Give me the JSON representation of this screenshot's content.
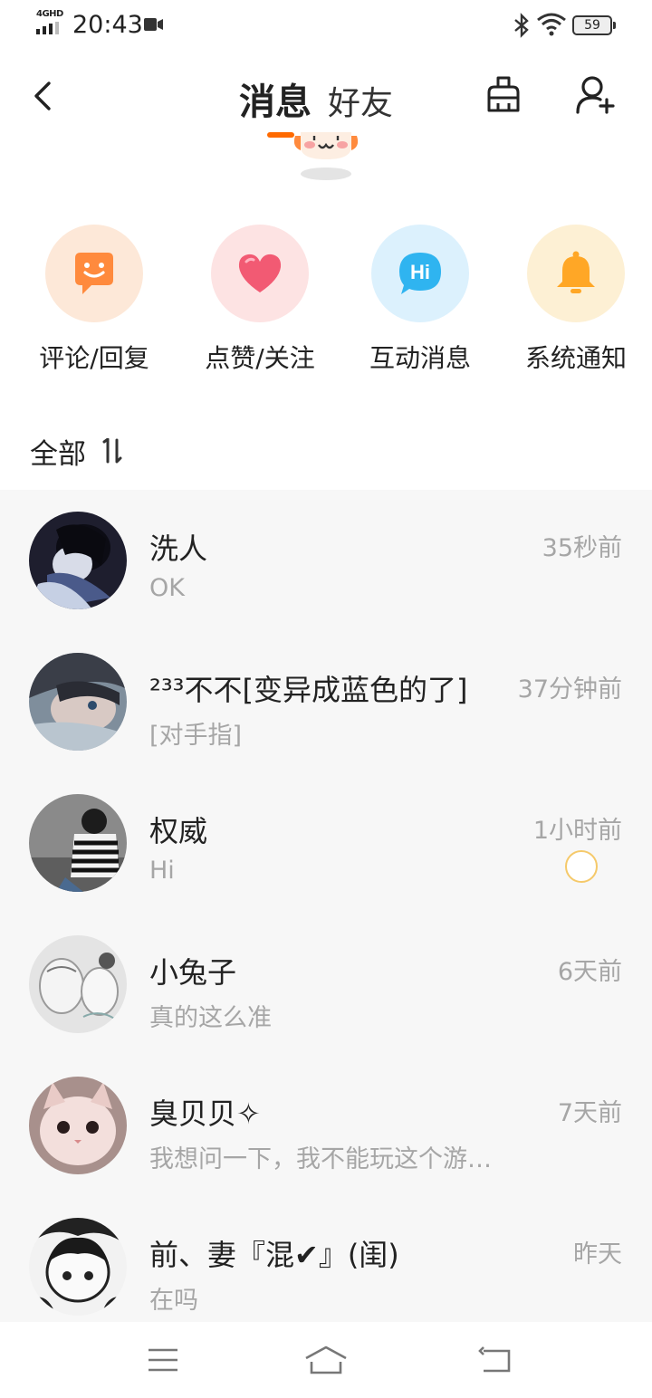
{
  "status_bar": {
    "network": "4GHD",
    "time": "20:43",
    "battery": "59"
  },
  "header": {
    "tabs": [
      {
        "label": "消息",
        "active": true
      },
      {
        "label": "好友",
        "active": false
      }
    ]
  },
  "shortcuts": [
    {
      "label": "评论/回复",
      "icon": "comment-smile-icon",
      "bg": "#fde8d8",
      "color": "#ff8a3d"
    },
    {
      "label": "点赞/关注",
      "icon": "heart-icon",
      "bg": "#fde3e3",
      "color": "#f25a73"
    },
    {
      "label": "互动消息",
      "icon": "hi-bubble-icon",
      "bg": "#dcf1fd",
      "color": "#2fb4f0"
    },
    {
      "label": "系统通知",
      "icon": "bell-icon",
      "bg": "#fdf0d4",
      "color": "#ffa726"
    }
  ],
  "sort": {
    "label": "全部",
    "icon": "sort-icon"
  },
  "conversations": [
    {
      "name": "洗人",
      "preview": "OK",
      "time": "35秒前",
      "avatar_color": "#30304a"
    },
    {
      "name": "²³³不不[变异成蓝色的了]",
      "preview": "[对手指]",
      "time": "37分钟前",
      "avatar_color": "#8898a6"
    },
    {
      "name": "权威",
      "preview": "Hi",
      "time": "1小时前",
      "avatar_color": "#5a5a5a"
    },
    {
      "name": "小兔子",
      "preview": "真的这么准",
      "time": "6天前",
      "avatar_color": "#d6d6d6"
    },
    {
      "name": "臭贝贝✧",
      "preview": "我想问一下，我不能玩这个游…",
      "time": "7天前",
      "avatar_color": "#d8b6b0"
    },
    {
      "name": "前、妻『混✔』(闺)",
      "preview": "在吗",
      "time": "昨天",
      "avatar_color": "#3a3a3a"
    }
  ]
}
